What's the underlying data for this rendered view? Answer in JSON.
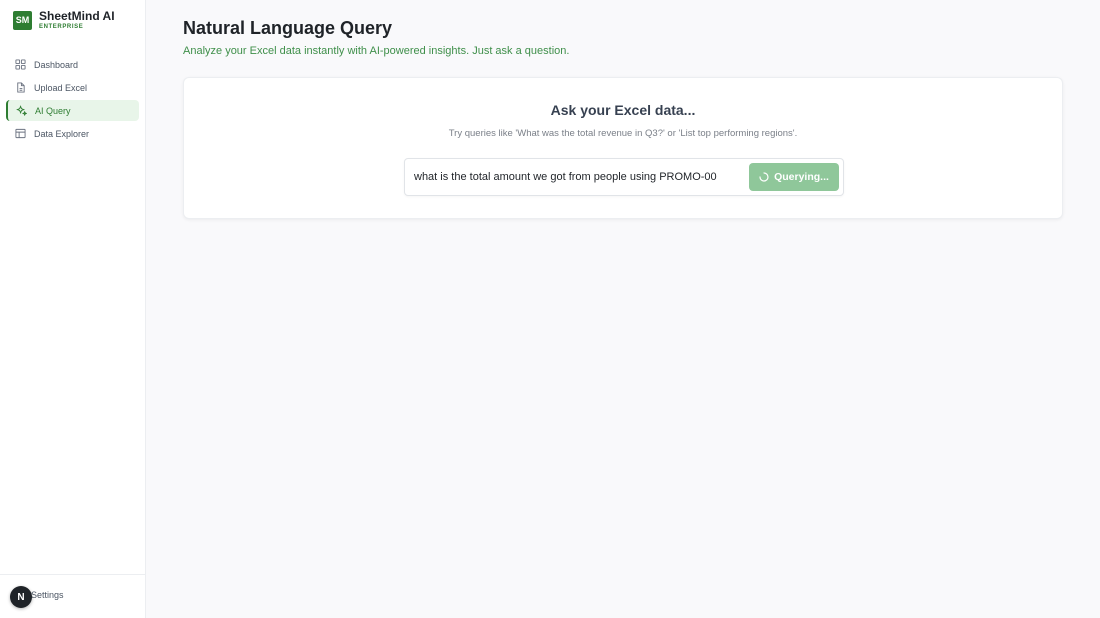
{
  "brand": {
    "logo_text": "SM",
    "name": "SheetMind AI",
    "tier": "ENTERPRISE"
  },
  "sidebar": {
    "items": [
      {
        "label": "Dashboard",
        "icon": "grid-icon",
        "active": false
      },
      {
        "label": "Upload Excel",
        "icon": "file-icon",
        "active": false
      },
      {
        "label": "AI Query",
        "icon": "sparkles-icon",
        "active": true
      },
      {
        "label": "Data Explorer",
        "icon": "table-icon",
        "active": false
      }
    ],
    "settings_label": "Settings",
    "badge_text": "N"
  },
  "page": {
    "title": "Natural Language Query",
    "subtitle": "Analyze your Excel data instantly with AI-powered insights. Just ask a question."
  },
  "query_card": {
    "title": "Ask your Excel data...",
    "hint": "Try queries like 'What was the total revenue in Q3?' or 'List top performing regions'.",
    "input_value": "what is the total amount we got from people using PROMO-00",
    "button_label": "Querying..."
  },
  "colors": {
    "accent": "#2e7d32",
    "button_loading": "#8fc79a",
    "subtitle": "#3f8f4a"
  }
}
